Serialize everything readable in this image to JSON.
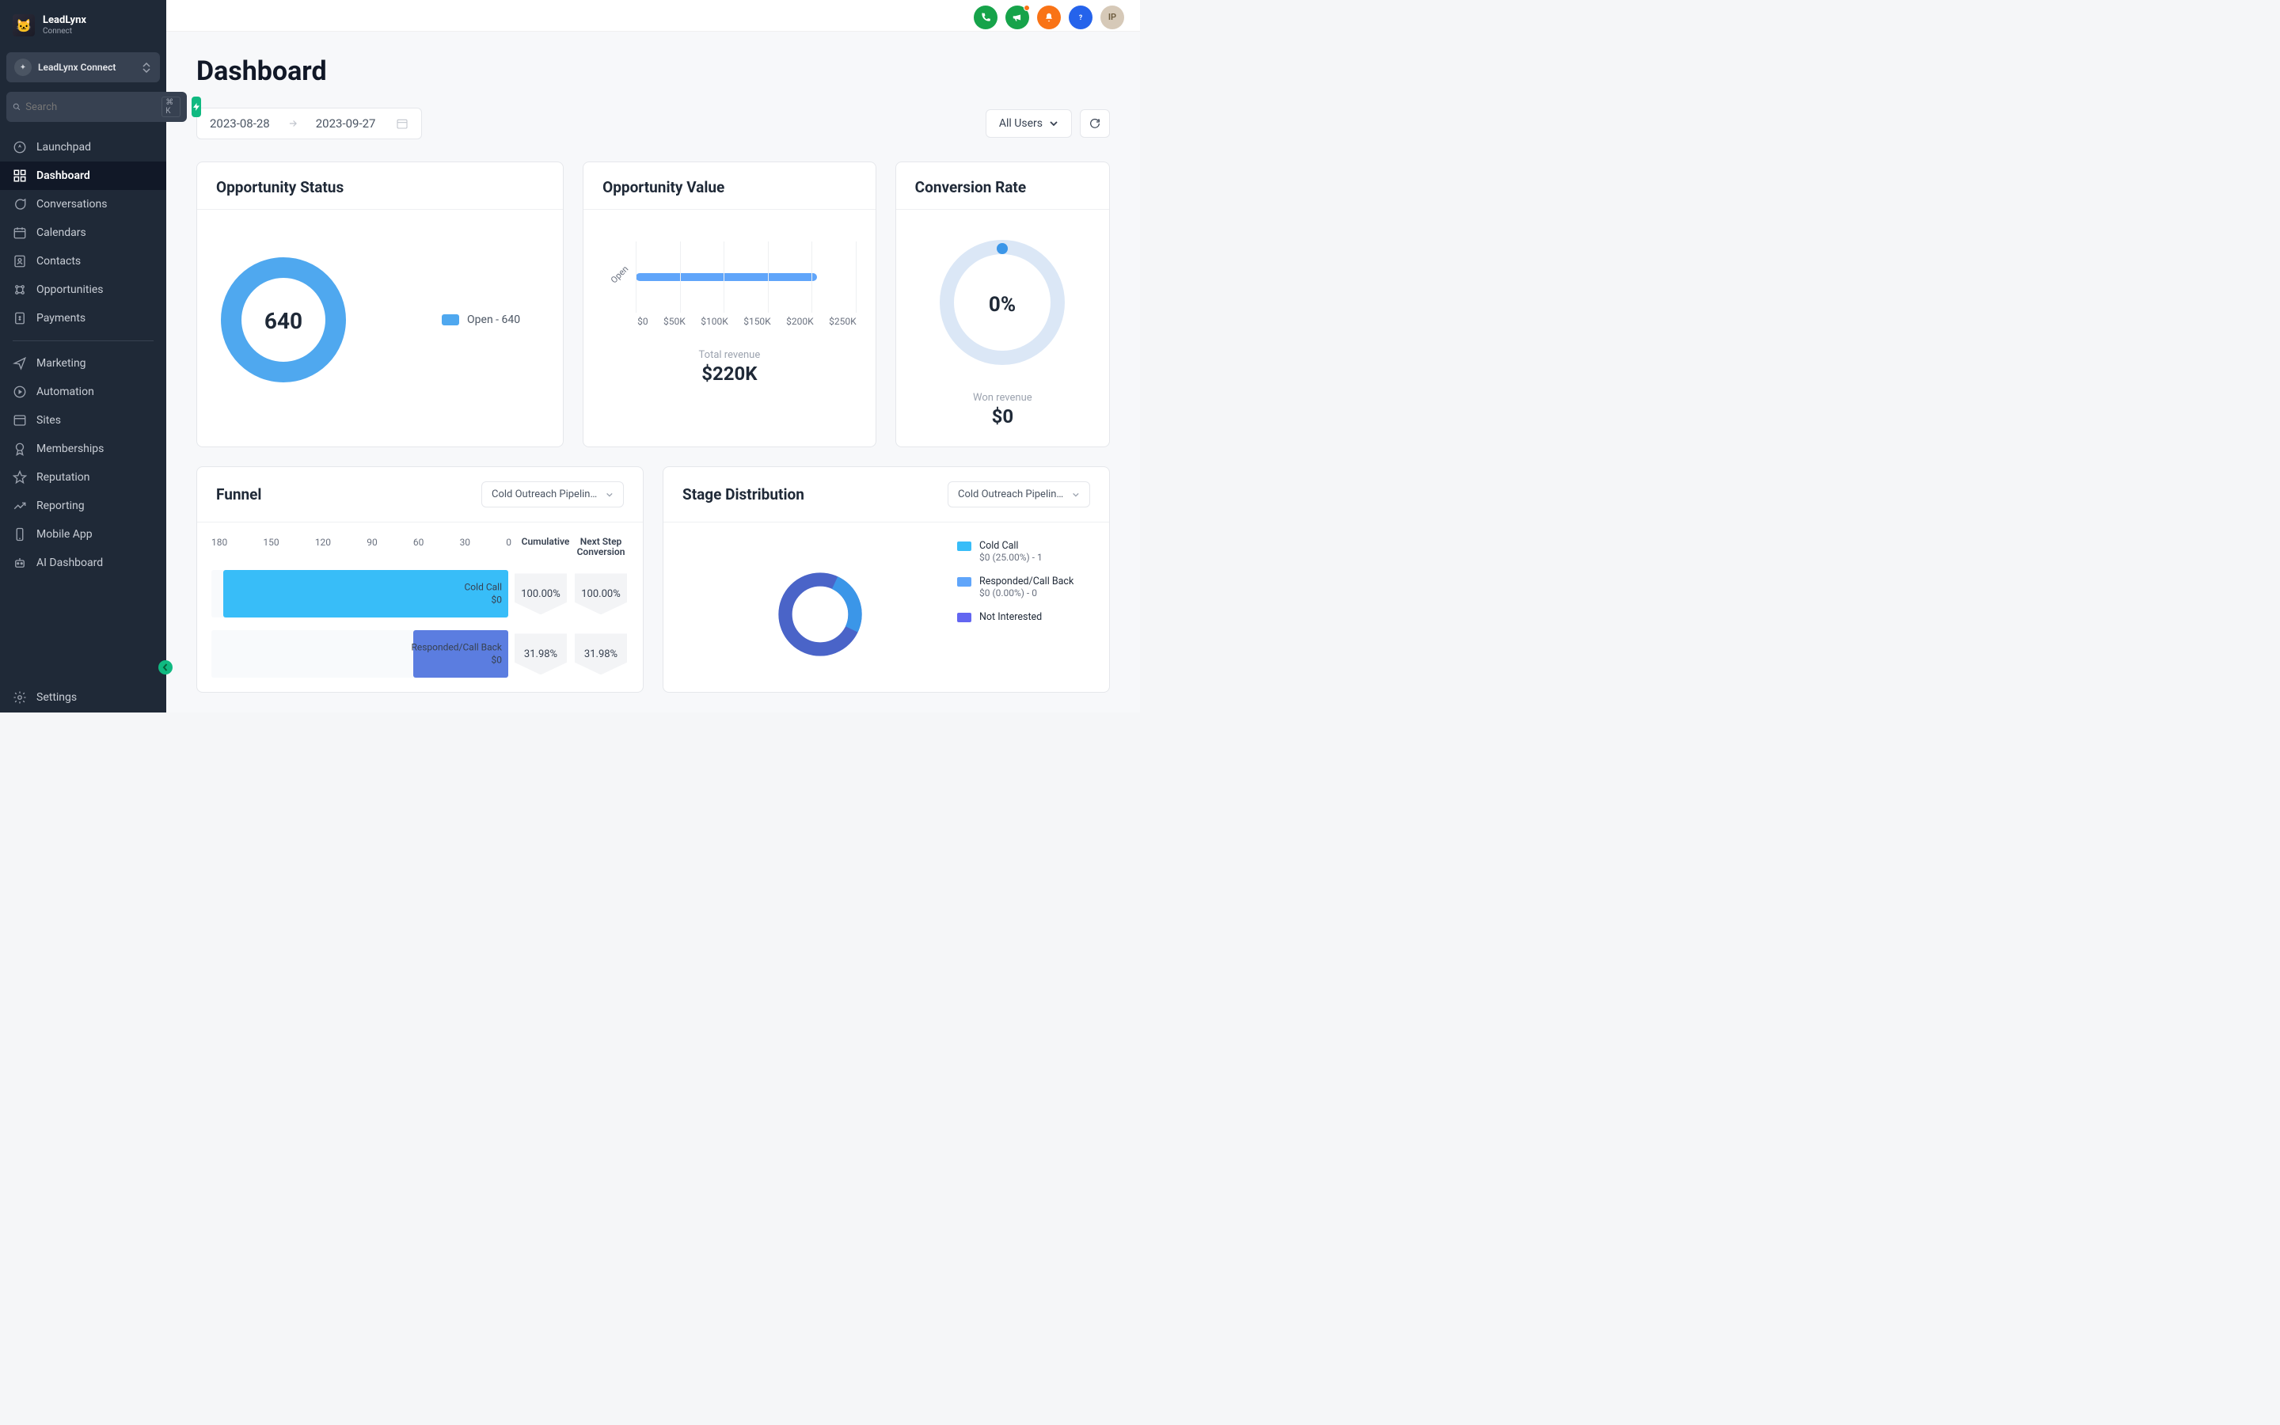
{
  "brand": {
    "name": "LeadLynx",
    "sub": "Connect"
  },
  "workspace": {
    "name": "LeadLynx Connect"
  },
  "search": {
    "placeholder": "Search",
    "shortcut": "⌘ K"
  },
  "nav": {
    "group1": [
      {
        "label": "Launchpad"
      },
      {
        "label": "Dashboard",
        "active": true
      },
      {
        "label": "Conversations"
      },
      {
        "label": "Calendars"
      },
      {
        "label": "Contacts"
      },
      {
        "label": "Opportunities"
      },
      {
        "label": "Payments"
      }
    ],
    "group2": [
      {
        "label": "Marketing"
      },
      {
        "label": "Automation"
      },
      {
        "label": "Sites"
      },
      {
        "label": "Memberships"
      },
      {
        "label": "Reputation"
      },
      {
        "label": "Reporting"
      },
      {
        "label": "Mobile App"
      },
      {
        "label": "AI Dashboard"
      }
    ],
    "settings": "Settings"
  },
  "topbar": {
    "avatar_initials": "IP"
  },
  "page": {
    "title": "Dashboard"
  },
  "date_range": {
    "start": "2023-08-28",
    "end": "2023-09-27"
  },
  "users_filter": "All Users",
  "opportunity_status": {
    "title": "Opportunity Status",
    "center_value": "640",
    "legend": "Open - 640",
    "color": "#4fa8ef"
  },
  "opportunity_value": {
    "title": "Opportunity Value",
    "series_label": "Open",
    "ticks": [
      "$0",
      "$50K",
      "$100K",
      "$150K",
      "$200K",
      "$250K"
    ],
    "metric_label": "Total revenue",
    "metric_value": "$220K"
  },
  "conversion_rate": {
    "title": "Conversion Rate",
    "percent": "0%",
    "metric_label": "Won revenue",
    "metric_value": "$0"
  },
  "funnel": {
    "title": "Funnel",
    "pipeline": "Cold Outreach Pipeline...",
    "axis": [
      "180",
      "150",
      "120",
      "90",
      "60",
      "30",
      "0"
    ],
    "col_cum": "Cumulative",
    "col_next": "Next Step Conversion",
    "rows": [
      {
        "name": "Cold Call",
        "amount": "$0",
        "cumulative": "100.00%",
        "next": "100.00%",
        "width_pct": 96,
        "left_pct": 4,
        "color": "#38bdf8"
      },
      {
        "name": "Responded/Call Back",
        "amount": "$0",
        "cumulative": "31.98%",
        "next": "31.98%",
        "width_pct": 30,
        "left_pct": 70,
        "color": "#6366f1"
      }
    ]
  },
  "stage": {
    "title": "Stage Distribution",
    "pipeline": "Cold Outreach Pipeline...",
    "legend": [
      {
        "name": "Cold Call",
        "detail": "$0 (25.00%) - 1",
        "color": "#38bdf8"
      },
      {
        "name": "Responded/Call Back",
        "detail": "$0 (0.00%) - 0",
        "color": "#60a5fa"
      },
      {
        "name": "Not Interested",
        "detail": "",
        "color": "#6366f1"
      }
    ]
  },
  "chart_data": [
    {
      "type": "pie",
      "title": "Opportunity Status",
      "series": [
        {
          "name": "Open",
          "value": 640
        }
      ],
      "total": 640
    },
    {
      "type": "bar",
      "title": "Opportunity Value",
      "orientation": "horizontal",
      "categories": [
        "Open"
      ],
      "values": [
        220000
      ],
      "xlabel": "",
      "ylabel": "",
      "xlim": [
        0,
        250000
      ],
      "ticks": [
        0,
        50000,
        100000,
        150000,
        200000,
        250000
      ]
    },
    {
      "type": "pie",
      "title": "Conversion Rate",
      "values": [
        0
      ],
      "percent": 0,
      "metric": {
        "label": "Won revenue",
        "value": 0
      }
    },
    {
      "type": "bar",
      "title": "Funnel — Cold Outreach Pipeline",
      "orientation": "horizontal",
      "categories": [
        "Cold Call",
        "Responded/Call Back"
      ],
      "values": [
        172,
        55
      ],
      "xlim": [
        0,
        180
      ],
      "columns": {
        "Cumulative": [
          "100.00%",
          "31.98%"
        ],
        "Next Step Conversion": [
          "100.00%",
          "31.98%"
        ]
      }
    },
    {
      "type": "pie",
      "title": "Stage Distribution — Cold Outreach Pipeline",
      "series": [
        {
          "name": "Cold Call",
          "value": 1,
          "percent": 25.0,
          "amount": 0
        },
        {
          "name": "Responded/Call Back",
          "value": 0,
          "percent": 0.0,
          "amount": 0
        },
        {
          "name": "Not Interested",
          "value": null
        }
      ]
    }
  ]
}
